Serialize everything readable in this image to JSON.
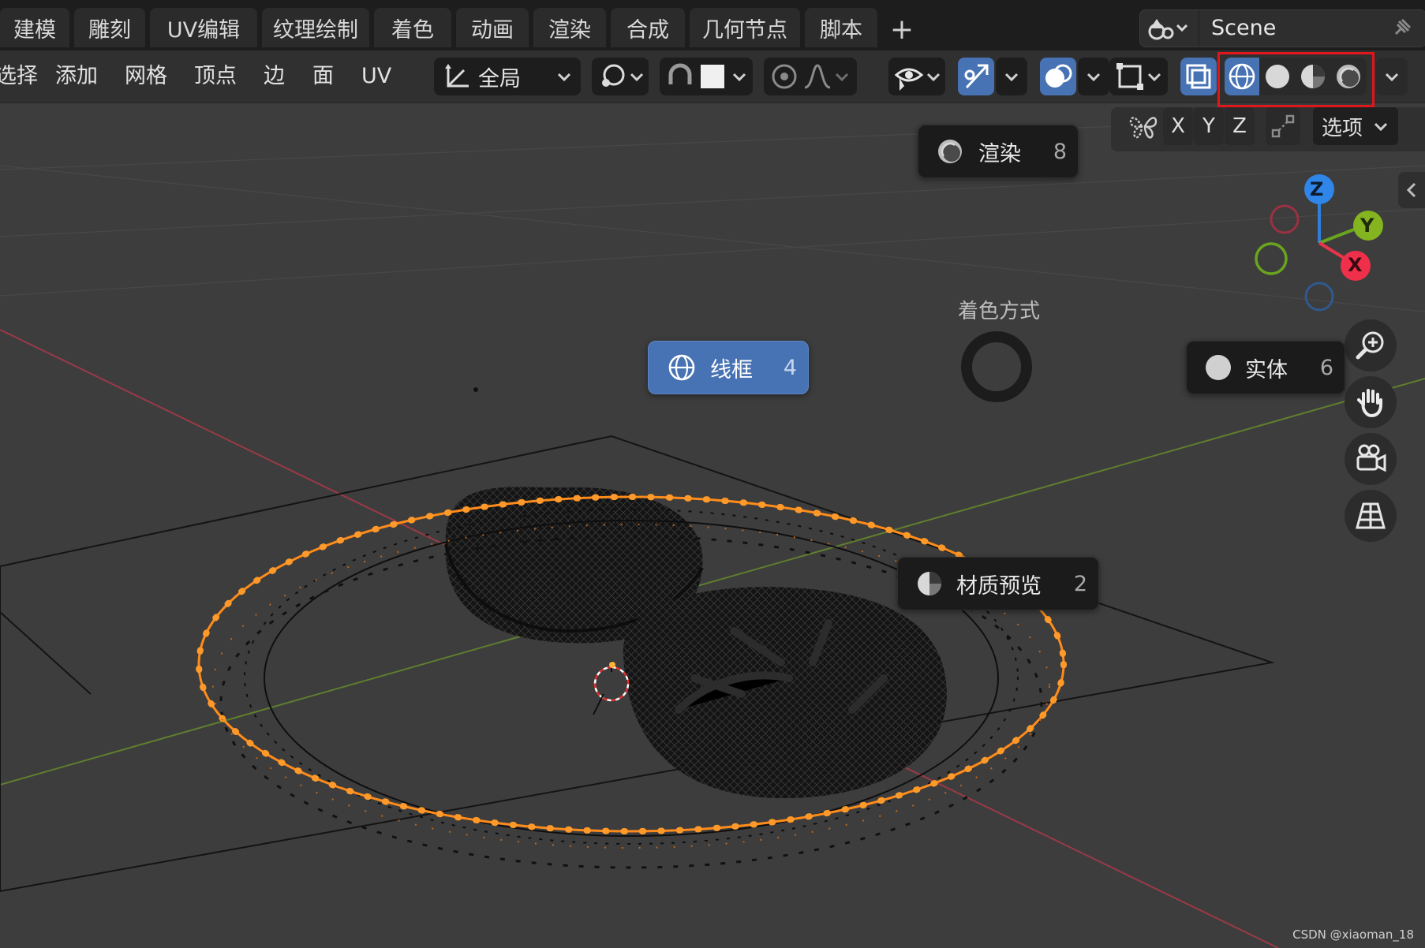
{
  "workspace_tabs": [
    {
      "label": "建模"
    },
    {
      "label": "雕刻"
    },
    {
      "label": "UV编辑"
    },
    {
      "label": "纹理绘制"
    },
    {
      "label": "着色"
    },
    {
      "label": "动画"
    },
    {
      "label": "渲染"
    },
    {
      "label": "合成"
    },
    {
      "label": "几何节点"
    },
    {
      "label": "脚本"
    }
  ],
  "add_tab_label": "+",
  "scene": {
    "name": "Scene"
  },
  "menu": [
    "选择",
    "添加",
    "网格",
    "顶点",
    "边",
    "面",
    "UV"
  ],
  "transform_orientation": "全局",
  "axis_toggles": [
    "X",
    "Y",
    "Z"
  ],
  "options_label": "选项",
  "pie_menu": {
    "title": "着色方式",
    "items": {
      "wireframe": {
        "label": "线框",
        "key": "4"
      },
      "solid": {
        "label": "实体",
        "key": "6"
      },
      "material": {
        "label": "材质预览",
        "key": "2"
      },
      "rendered": {
        "label": "渲染",
        "key": "8"
      }
    }
  },
  "gizmo": {
    "x": "X",
    "y": "Y",
    "z": "Z"
  },
  "colors": {
    "accent": "#4772b3",
    "highlight": "#e0161b",
    "selection": "#ff8c1a"
  },
  "watermark": "CSDN @xiaoman_18"
}
